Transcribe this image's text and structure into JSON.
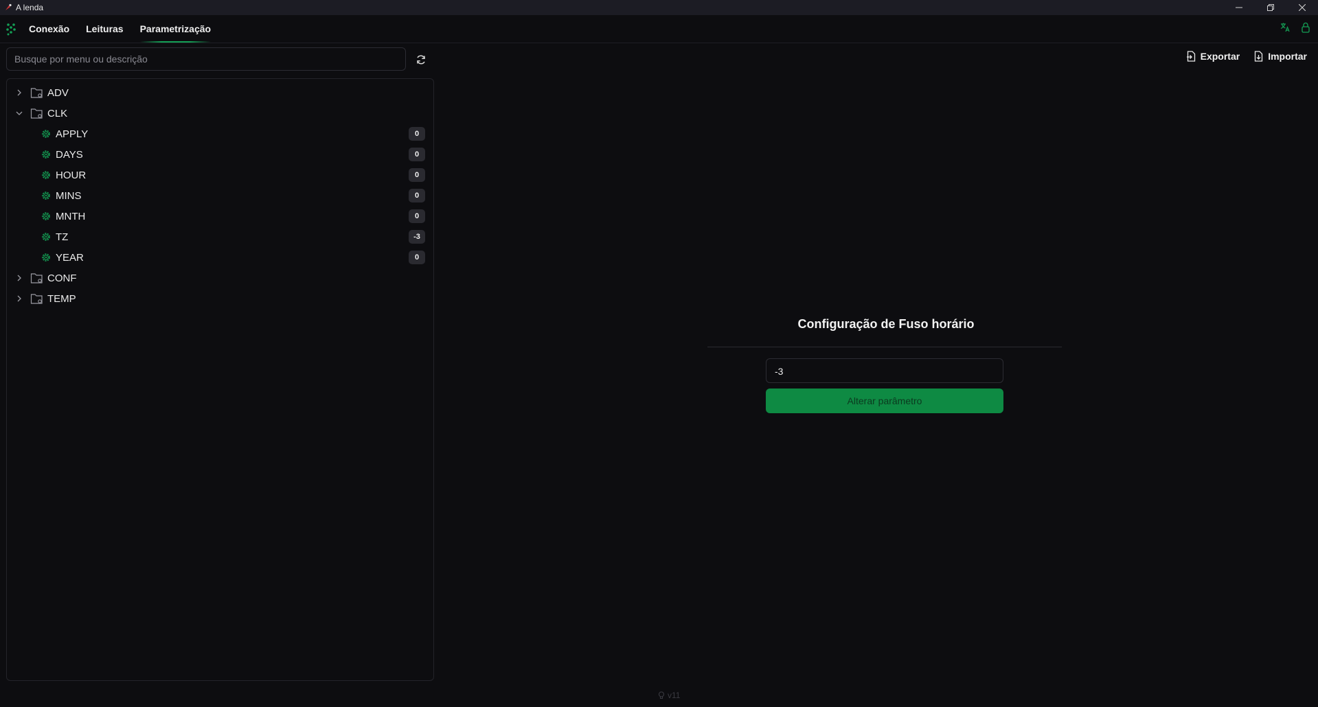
{
  "window": {
    "title": "A lenda"
  },
  "menu": {
    "tabs": [
      {
        "label": "Conexão"
      },
      {
        "label": "Leituras"
      },
      {
        "label": "Parametrização",
        "active": true
      }
    ]
  },
  "search": {
    "placeholder": "Busque por menu ou descrição",
    "value": ""
  },
  "actions": {
    "export_label": "Exportar",
    "import_label": "Importar"
  },
  "tree": {
    "folders": [
      {
        "label": "ADV",
        "expanded": false
      },
      {
        "label": "CLK",
        "expanded": true,
        "items": [
          {
            "label": "APPLY",
            "value": "0"
          },
          {
            "label": "DAYS",
            "value": "0"
          },
          {
            "label": "HOUR",
            "value": "0"
          },
          {
            "label": "MINS",
            "value": "0"
          },
          {
            "label": "MNTH",
            "value": "0"
          },
          {
            "label": "TZ",
            "value": "-3"
          },
          {
            "label": "YEAR",
            "value": "0"
          }
        ]
      },
      {
        "label": "CONF",
        "expanded": false
      },
      {
        "label": "TEMP",
        "expanded": false
      }
    ]
  },
  "detail": {
    "title": "Configuração de Fuso horário",
    "input_value": "-3",
    "button_label": "Alterar parâmetro"
  },
  "footer": {
    "version": "v11"
  },
  "colors": {
    "accent": "#14a055",
    "button": "#0e8a43",
    "background": "#0d0d10"
  }
}
